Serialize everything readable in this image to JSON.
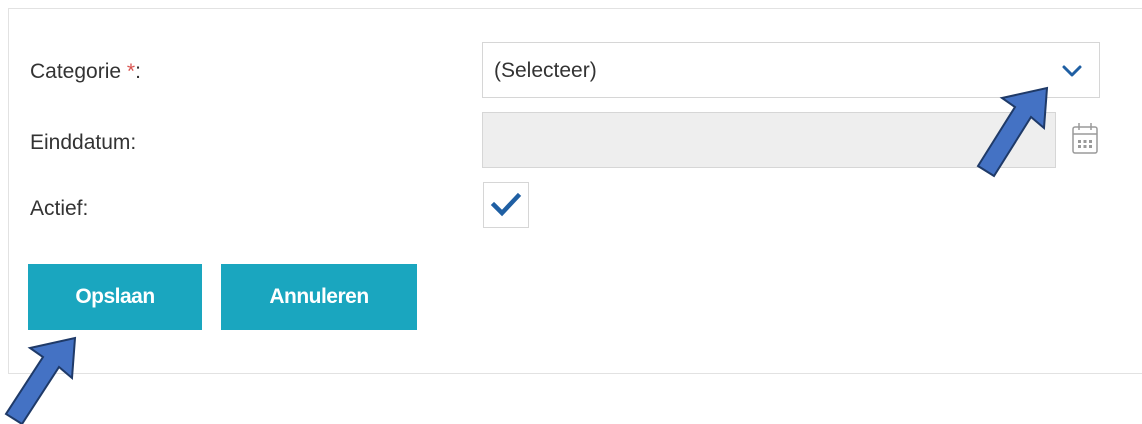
{
  "form": {
    "category_label": "Categorie ",
    "category_required_mark": "*",
    "category_colon": ":",
    "category_value": "(Selecteer)",
    "enddate_label": "Einddatum:",
    "enddate_value": "",
    "active_label": "Actief:",
    "active_checked": true
  },
  "buttons": {
    "save_label": "Opslaan",
    "cancel_label": "Annuleren"
  },
  "icons": {
    "chevron": "chevron-down-icon",
    "calendar": "calendar-icon",
    "check": "checkmark-icon",
    "pointer": "annotation-arrow"
  },
  "colors": {
    "accent": "#1aa6bf",
    "check": "#1f5fa3",
    "required": "#d9534f",
    "arrow_fill": "#4472c4",
    "arrow_stroke": "#1f3a68",
    "disabled_bg": "#eeeeee"
  }
}
